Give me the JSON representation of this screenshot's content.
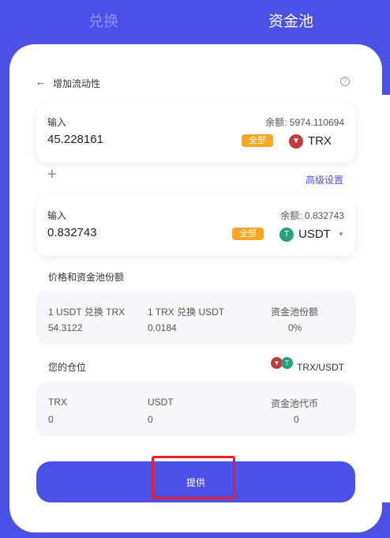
{
  "tabs": {
    "swap": "兑换",
    "pool": "资金池"
  },
  "header": {
    "title": "增加流动性"
  },
  "input1": {
    "label": "输入",
    "balance": "余额: 5974.110694",
    "amount": "45.228161",
    "max_label": "全部",
    "token": "TRX"
  },
  "advanced_label": "高级设置",
  "input2": {
    "label": "输入",
    "balance": "余额: 0.832743",
    "amount": "0.832743",
    "max_label": "全部",
    "token": "USDT"
  },
  "price_section": {
    "title": "价格和资金池份额",
    "col1_label": "1 USDT 兑换 TRX",
    "col1_value": "54.3122",
    "col2_label": "1 TRX 兑换 USDT",
    "col2_value": "0.0184",
    "col3_label": "资金池份额",
    "col3_value": "0%"
  },
  "position_section": {
    "title": "您的仓位",
    "pair": "TRX/USDT",
    "col1_label": "TRX",
    "col1_value": "0",
    "col2_label": "USDT",
    "col2_value": "0",
    "col3_label": "资金池代币",
    "col3_value": "0"
  },
  "submit_label": "提供",
  "colors": {
    "primary": "#4b50e6",
    "max_button": "#f5a623",
    "trx": "#c23a3e",
    "usdt": "#26a17b",
    "highlight": "#e8202a"
  },
  "icons": {
    "back": "arrow-left-icon",
    "help": "help-circle-icon",
    "trx": "trx-logo-icon",
    "usdt": "usdt-logo-icon",
    "plus": "plus-icon",
    "dropdown": "chevron-down-icon"
  }
}
